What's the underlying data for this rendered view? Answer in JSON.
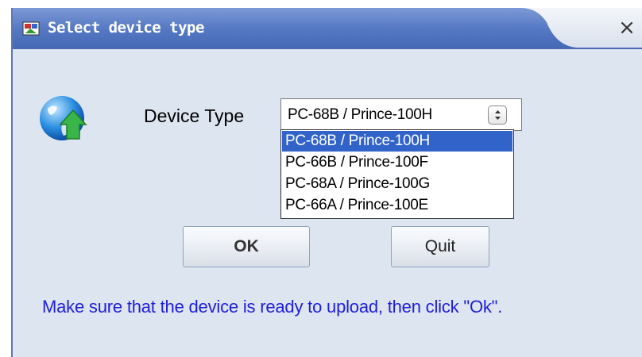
{
  "window": {
    "title": "Select device type",
    "close_symbol": "×",
    "title_icon": "app-icon",
    "colors": {
      "titlebar": "#5679c4",
      "background": "#dde5f1",
      "message": "#1e1edc",
      "selection": "#3163c8"
    }
  },
  "form": {
    "icon": "globe-upload-icon",
    "device_label": "Device Type",
    "select": {
      "value": "PC-68B / Prince-100H",
      "options": [
        "PC-68B / Prince-100H",
        "PC-66B / Prince-100F",
        "PC-68A / Prince-100G",
        "PC-66A / Prince-100E"
      ],
      "expanded": true,
      "highlighted_index": 0
    }
  },
  "buttons": {
    "ok": "OK",
    "quit": "Quit"
  },
  "message": "Make sure that the device is ready to upload, then click \"Ok\"."
}
